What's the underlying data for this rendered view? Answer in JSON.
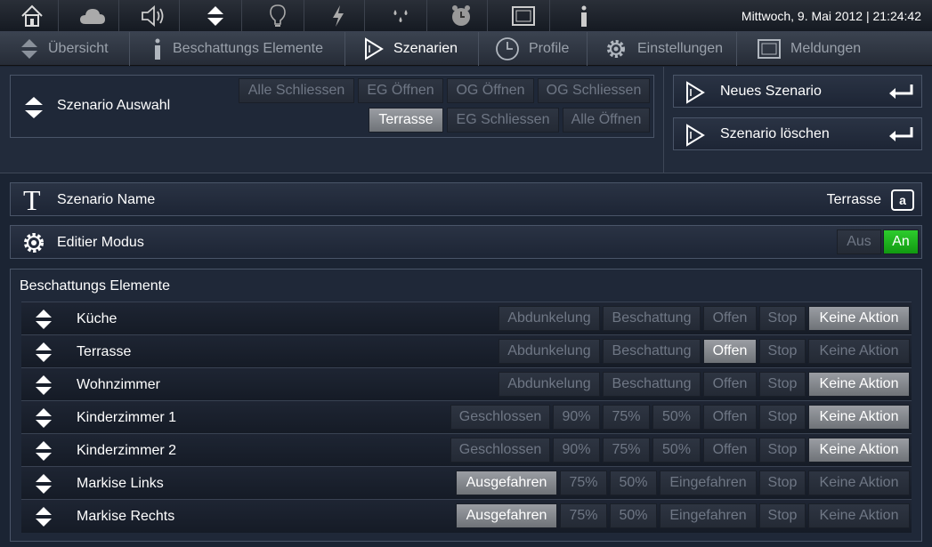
{
  "topbar": {
    "datetime": "Mittwoch, 9. Mai 2012 | 21:24:42",
    "icons": [
      "home-icon",
      "cloud-icon",
      "speaker-icon",
      "updown-arrows-icon",
      "bulb-icon",
      "lightning-icon",
      "drops-icon",
      "alarm-clock-icon",
      "screen-icon",
      "info-icon"
    ]
  },
  "nav": {
    "items": [
      {
        "label": "Übersicht",
        "icon": "updown-arrows-icon",
        "active": false
      },
      {
        "label": "Beschattungs Elemente",
        "icon": "info-icon",
        "active": false
      },
      {
        "label": "Szenarien",
        "icon": "play-icon",
        "active": true
      },
      {
        "label": "Profile",
        "icon": "clock-icon",
        "active": false
      },
      {
        "label": "Einstellungen",
        "icon": "gear-icon",
        "active": false
      },
      {
        "label": "Meldungen",
        "icon": "screen-icon",
        "active": false
      }
    ]
  },
  "scenario_select": {
    "label": "Szenario Auswahl",
    "buttons": [
      {
        "label": "Alle Schliessen",
        "active": false
      },
      {
        "label": "EG Öffnen",
        "active": false
      },
      {
        "label": "OG Öffnen",
        "active": false
      },
      {
        "label": "OG Schliessen",
        "active": false
      },
      {
        "label": "Terrasse",
        "active": true
      },
      {
        "label": "EG Schliessen",
        "active": false
      },
      {
        "label": "Alle Öffnen",
        "active": false
      }
    ]
  },
  "actions": {
    "new_label": "Neues Szenario",
    "delete_label": "Szenario löschen"
  },
  "scenario_name": {
    "label": "Szenario Name",
    "value": "Terrasse",
    "keyboard_key": "a"
  },
  "edit_mode": {
    "label": "Editier Modus",
    "off_label": "Aus",
    "on_label": "An",
    "state": "An"
  },
  "elements": {
    "title": "Beschattungs Elemente",
    "rows": [
      {
        "name": "Küche",
        "options": [
          "Abdunkelung",
          "Beschattung",
          "Offen",
          "Stop",
          "Keine Aktion"
        ],
        "selected": "Keine Aktion"
      },
      {
        "name": "Terrasse",
        "options": [
          "Abdunkelung",
          "Beschattung",
          "Offen",
          "Stop",
          "Keine Aktion"
        ],
        "selected": "Offen"
      },
      {
        "name": "Wohnzimmer",
        "options": [
          "Abdunkelung",
          "Beschattung",
          "Offen",
          "Stop",
          "Keine Aktion"
        ],
        "selected": "Keine Aktion"
      },
      {
        "name": "Kinderzimmer 1",
        "options": [
          "Geschlossen",
          "90%",
          "75%",
          "50%",
          "Offen",
          "Stop",
          "Keine Aktion"
        ],
        "selected": "Keine Aktion"
      },
      {
        "name": "Kinderzimmer 2",
        "options": [
          "Geschlossen",
          "90%",
          "75%",
          "50%",
          "Offen",
          "Stop",
          "Keine Aktion"
        ],
        "selected": "Keine Aktion"
      },
      {
        "name": "Markise Links",
        "options": [
          "Ausgefahren",
          "75%",
          "50%",
          "Eingefahren",
          "Stop",
          "Keine Aktion"
        ],
        "selected": "Ausgefahren"
      },
      {
        "name": "Markise Rechts",
        "options": [
          "Ausgefahren",
          "75%",
          "50%",
          "Eingefahren",
          "Stop",
          "Keine Aktion"
        ],
        "selected": "Ausgefahren"
      }
    ]
  },
  "colors": {
    "background": "#1b2433",
    "active_green": "#22bb22",
    "selected_grey": "#8a8d92"
  }
}
